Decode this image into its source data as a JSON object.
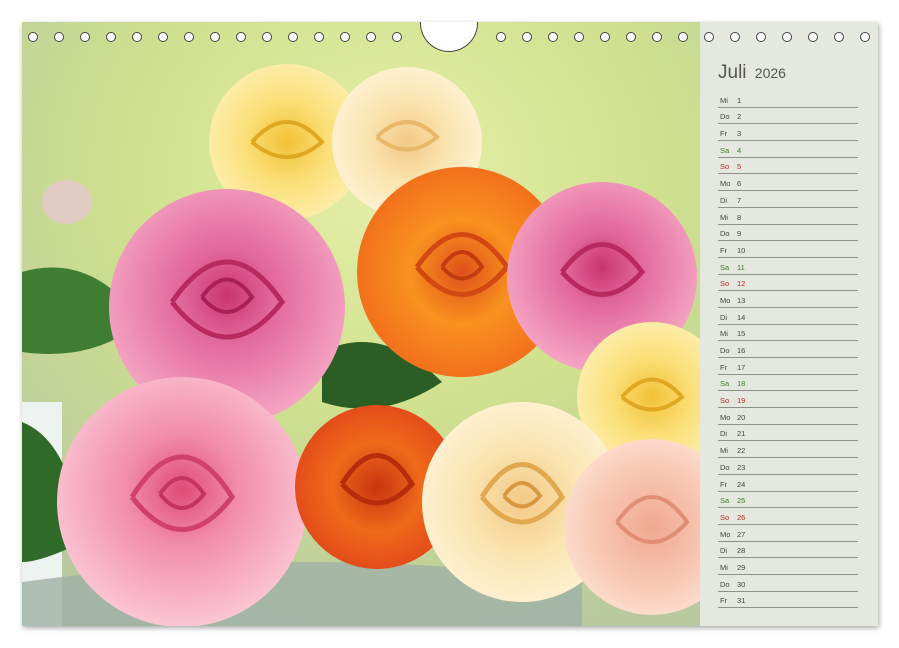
{
  "calendar": {
    "month": "Juli",
    "year": "2026",
    "days": [
      {
        "dn": "Mi",
        "d": "1",
        "type": "wd"
      },
      {
        "dn": "Do",
        "d": "2",
        "type": "wd"
      },
      {
        "dn": "Fr",
        "d": "3",
        "type": "wd"
      },
      {
        "dn": "Sa",
        "d": "4",
        "type": "sa"
      },
      {
        "dn": "So",
        "d": "5",
        "type": "so"
      },
      {
        "dn": "Mo",
        "d": "6",
        "type": "wd"
      },
      {
        "dn": "Di",
        "d": "7",
        "type": "wd"
      },
      {
        "dn": "Mi",
        "d": "8",
        "type": "wd"
      },
      {
        "dn": "Do",
        "d": "9",
        "type": "wd"
      },
      {
        "dn": "Fr",
        "d": "10",
        "type": "wd"
      },
      {
        "dn": "Sa",
        "d": "11",
        "type": "sa"
      },
      {
        "dn": "So",
        "d": "12",
        "type": "so"
      },
      {
        "dn": "Mo",
        "d": "13",
        "type": "wd"
      },
      {
        "dn": "Di",
        "d": "14",
        "type": "wd"
      },
      {
        "dn": "Mi",
        "d": "15",
        "type": "wd"
      },
      {
        "dn": "Do",
        "d": "16",
        "type": "wd"
      },
      {
        "dn": "Fr",
        "d": "17",
        "type": "wd"
      },
      {
        "dn": "Sa",
        "d": "18",
        "type": "sa"
      },
      {
        "dn": "So",
        "d": "19",
        "type": "so"
      },
      {
        "dn": "Mo",
        "d": "20",
        "type": "wd"
      },
      {
        "dn": "Di",
        "d": "21",
        "type": "wd"
      },
      {
        "dn": "Mi",
        "d": "22",
        "type": "wd"
      },
      {
        "dn": "Do",
        "d": "23",
        "type": "wd"
      },
      {
        "dn": "Fr",
        "d": "24",
        "type": "wd"
      },
      {
        "dn": "Sa",
        "d": "25",
        "type": "sa"
      },
      {
        "dn": "So",
        "d": "26",
        "type": "so"
      },
      {
        "dn": "Mo",
        "d": "27",
        "type": "wd"
      },
      {
        "dn": "Di",
        "d": "28",
        "type": "wd"
      },
      {
        "dn": "Mi",
        "d": "29",
        "type": "wd"
      },
      {
        "dn": "Do",
        "d": "30",
        "type": "wd"
      },
      {
        "dn": "Fr",
        "d": "31",
        "type": "wd"
      }
    ]
  },
  "colors": {
    "panel_bg": "#e4e8de",
    "weekday_text": "#444444",
    "saturday_text": "#3d7a2a",
    "sunday_text": "#c0282a"
  },
  "photo": {
    "icon": "rose-bouquet-photo"
  }
}
